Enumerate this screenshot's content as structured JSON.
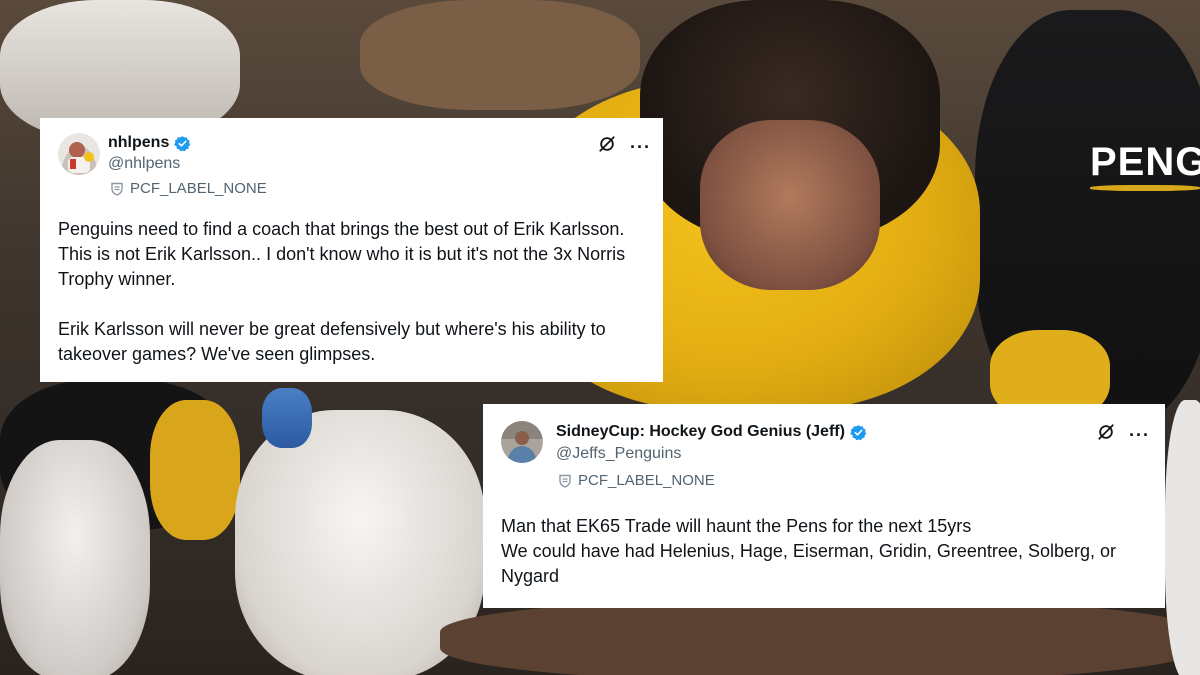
{
  "tweets": [
    {
      "display_name": "nhlpens",
      "handle": "@nhlpens",
      "label": "PCF_LABEL_NONE",
      "verified": true,
      "body_paragraphs": [
        "Penguins need to find a coach that brings the best out of Erik Karlsson. This is not Erik Karlsson.. I don't know who it is but it's not the 3x Norris Trophy winner.",
        "Erik Karlsson will never be great defensively but where's his ability to takeover games? We've seen glimpses."
      ],
      "more_label": "···"
    },
    {
      "display_name": "SidneyCup: Hockey God Genius (Jeff)",
      "handle": "@Jeffs_Penguins",
      "label": "PCF_LABEL_NONE",
      "verified": true,
      "body_lines": [
        "Man that EK65 Trade will haunt the Pens for the next 15yrs",
        "We could have had Helenius, Hage, Eiserman, Gridin, Greentree, Solberg, or Nygard"
      ],
      "more_label": "···"
    }
  ],
  "background": {
    "jersey_logo_text": "PENG"
  },
  "colors": {
    "verified_blue": "#1d9bf0",
    "card_bg": "#ffffff",
    "text_primary": "#0f1419",
    "text_secondary": "#536471",
    "penguins_gold": "#fcb514"
  },
  "icons": {
    "verified": "verified-badge-icon",
    "label": "shield-icon",
    "grok": "grok-icon",
    "more": "more-icon"
  }
}
